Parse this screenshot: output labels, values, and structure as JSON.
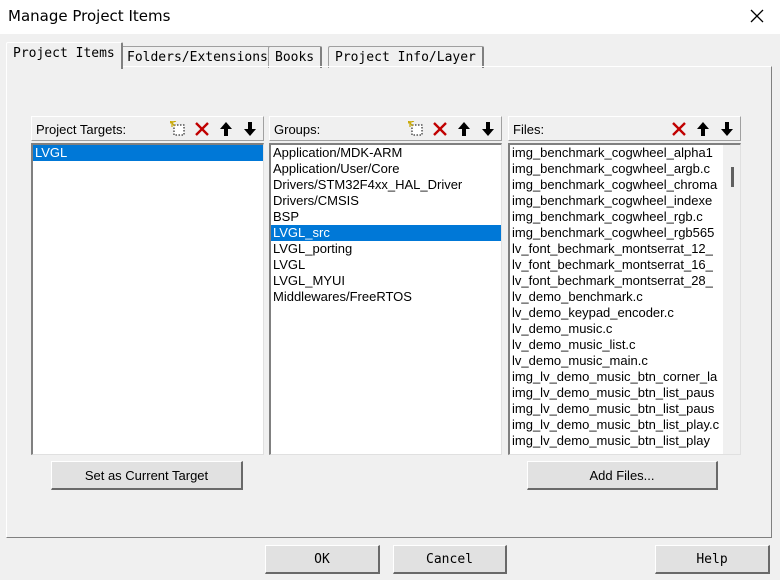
{
  "window": {
    "title": "Manage Project Items"
  },
  "tabs": [
    {
      "label": "Project Items",
      "active": true
    },
    {
      "label": "Folders/Extensions",
      "active": false
    },
    {
      "label": "Books",
      "active": false
    },
    {
      "label": "Project Info/Layer",
      "active": false
    }
  ],
  "targets": {
    "label": "Project Targets:",
    "items": [
      "LVGL"
    ],
    "selected": 0
  },
  "groups": {
    "label": "Groups:",
    "items": [
      "Application/MDK-ARM",
      "Application/User/Core",
      "Drivers/STM32F4xx_HAL_Driver",
      "Drivers/CMSIS",
      "BSP",
      "LVGL_src",
      "LVGL_porting",
      "LVGL",
      "LVGL_MYUI",
      "Middlewares/FreeRTOS"
    ],
    "selected": 5
  },
  "files": {
    "label": "Files:",
    "items": [
      "img_benchmark_cogwheel_alpha1",
      "img_benchmark_cogwheel_argb.c",
      "img_benchmark_cogwheel_chroma",
      "img_benchmark_cogwheel_indexe",
      "img_benchmark_cogwheel_rgb.c",
      "img_benchmark_cogwheel_rgb565",
      "lv_font_bechmark_montserrat_12_",
      "lv_font_bechmark_montserrat_16_",
      "lv_font_bechmark_montserrat_28_",
      "lv_demo_benchmark.c",
      "lv_demo_keypad_encoder.c",
      "lv_demo_music.c",
      "lv_demo_music_list.c",
      "lv_demo_music_main.c",
      "img_lv_demo_music_btn_corner_la",
      "img_lv_demo_music_btn_list_paus",
      "img_lv_demo_music_btn_list_paus",
      "img_lv_demo_music_btn_list_play.c",
      "img_lv_demo_music_btn_list_play"
    ]
  },
  "buttons": {
    "set_current_target": "Set as Current Target",
    "add_files": "Add Files...",
    "ok": "OK",
    "cancel": "Cancel",
    "help": "Help"
  },
  "colors": {
    "selection": "#0078d7",
    "delete_icon": "#c00000"
  }
}
